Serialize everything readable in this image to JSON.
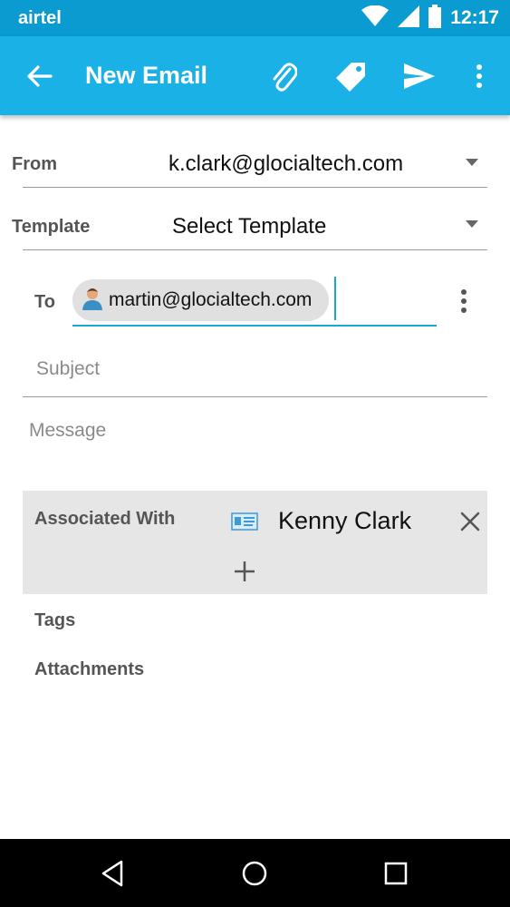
{
  "status_bar": {
    "carrier": "airtel",
    "time": "12:17",
    "icons": [
      "wifi-icon",
      "signal-icon",
      "battery-icon"
    ]
  },
  "app_bar": {
    "title": "New Email",
    "actions": [
      "back-arrow-icon",
      "paperclip-icon",
      "tag-icon",
      "send-icon",
      "overflow-menu-icon"
    ],
    "color": "#19b1e6"
  },
  "form": {
    "from_label": "From",
    "from_value": "k.clark@glocialtech.com",
    "template_label": "Template",
    "template_value": "Select Template",
    "to_label": "To",
    "to_chip": "martin@glocialtech.com",
    "subject_placeholder": "Subject",
    "message_placeholder": "Message"
  },
  "associated": {
    "label": "Associated With",
    "name": "Kenny Clark",
    "icons": [
      "contact-card-icon",
      "remove-icon",
      "add-icon"
    ]
  },
  "sections": {
    "tags_label": "Tags",
    "attachments_label": "Attachments"
  },
  "nav_bar": {
    "icons": [
      "back-triangle-icon",
      "home-circle-icon",
      "recents-square-icon"
    ]
  },
  "colors": {
    "accent": "#19a6d8",
    "panel": "#e6e6e6"
  }
}
